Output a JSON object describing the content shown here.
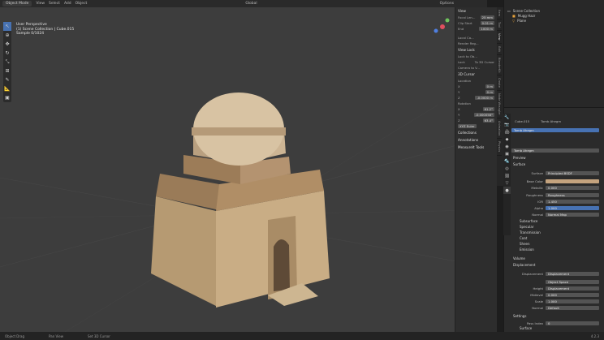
{
  "topbar": {
    "mode": "Object Mode",
    "menus": [
      "View",
      "Select",
      "Add",
      "Object"
    ],
    "transform": "Global",
    "options": "Options"
  },
  "viewport": {
    "info": [
      "User Perspective",
      "(1) Scene Collection | Cube.015",
      "Sample 0/1024"
    ]
  },
  "tools": [
    "cursor-icon",
    "select-icon",
    "move-icon",
    "rotate-icon",
    "scale-icon",
    "transform-icon",
    "annotate-icon",
    "measure-icon",
    "add-cube-icon"
  ],
  "npanel": {
    "view": "View",
    "focal": "Focal Len...",
    "focal_val": "25 mm",
    "clip_start": "Clip Start",
    "clip_start_val": "0.01 m",
    "clip_end": "End",
    "clip_end_val": "1000 m",
    "local_cam": "Local Ca...",
    "render_region": "Render Reg...",
    "view_lock": "View Lock",
    "lock_to": "Lock to Ob...",
    "lock": "Lock",
    "to3d": "To 3D Cursor",
    "cam_to_view": "Camera to V...",
    "cursor": "3D Cursor",
    "location": "Location",
    "loc": [
      [
        "X",
        "0 m"
      ],
      [
        "Y",
        "0 m"
      ],
      [
        "Z",
        "-0.0000 m"
      ]
    ],
    "rotation": "Rotation",
    "rot": [
      [
        "X",
        "61.2°"
      ],
      [
        "Y",
        "-0.000058°"
      ],
      [
        "Z",
        "63.4°"
      ]
    ],
    "xyz": "XYZ Euler",
    "collections": "Collections",
    "annotations": "Annotations",
    "measureit": "MeasureIt Tools"
  },
  "ntabs": [
    "Item",
    "Tool",
    "View",
    "Edit",
    "BlenderKit",
    "Create",
    "Node Wrangler",
    "Animation",
    "Physics"
  ],
  "outliner": {
    "title": "Scene Collection",
    "items": [
      "Mugg Hazr",
      "Plane"
    ]
  },
  "props": {
    "object": "Cube.015",
    "material": "Tomb Ahegm",
    "slot": "Tomb Ahegm",
    "preview": "Preview",
    "surface": "Surface",
    "surface_val": "Principled BSDF",
    "rows": [
      [
        "Base Color",
        ""
      ],
      [
        "Metallic",
        "0.000"
      ],
      [
        "Roughness",
        "Roughness"
      ],
      [
        "IOR",
        "1.450"
      ],
      [
        "Alpha",
        "1.000"
      ],
      [
        "Normal",
        "Normal Map"
      ]
    ],
    "sublist": [
      "Subsurface",
      "Specular",
      "Transmission",
      "Coat",
      "Sheen",
      "Emission"
    ],
    "volume": "Volume",
    "displacement": "Displacement",
    "disp_rows": [
      [
        "Displacement",
        "Displacement"
      ],
      [
        "",
        "Object Space"
      ],
      [
        "Height",
        "Displacement"
      ],
      [
        "Midlevel",
        "0.000"
      ],
      [
        "Scale",
        "1.000"
      ],
      [
        "Normal",
        "Default"
      ]
    ],
    "settings": "Settings",
    "pass_index": "Pass Index",
    "pass_val": "0",
    "surface2": "Surface"
  },
  "status": [
    "Object Drag",
    "Pan View",
    "Set 3D Cursor"
  ],
  "version": "4.2.3"
}
